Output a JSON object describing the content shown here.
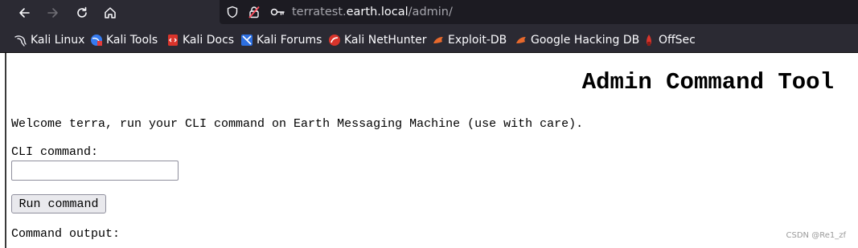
{
  "browser": {
    "url": {
      "prefix": "terratest.",
      "host": "earth.local",
      "path": "/admin/"
    },
    "bookmarks": [
      {
        "label": "Kali Linux",
        "icon": "kali-dragon-icon"
      },
      {
        "label": "Kali Tools",
        "icon": "kali-tools-icon"
      },
      {
        "label": "Kali Docs",
        "icon": "kali-docs-icon"
      },
      {
        "label": "Kali Forums",
        "icon": "kali-forums-icon"
      },
      {
        "label": "Kali NetHunter",
        "icon": "nethunter-icon"
      },
      {
        "label": "Exploit-DB",
        "icon": "exploit-db-icon"
      },
      {
        "label": "Google Hacking DB",
        "icon": "ghdb-icon"
      },
      {
        "label": "OffSec",
        "icon": "offsec-icon"
      }
    ],
    "colors": {
      "toolbar": "#2b2a33",
      "urlbar": "#1c1b22",
      "text": "#fbfbfe"
    }
  },
  "page": {
    "title": "Admin Command Tool",
    "welcome": "Welcome terra, run your CLI command on Earth Messaging Machine (use with care).",
    "cli_label": "CLI command:",
    "cli_value": "",
    "run_button": "Run command",
    "output_label": "Command output:"
  },
  "watermark": "CSDN @Re1_zf"
}
